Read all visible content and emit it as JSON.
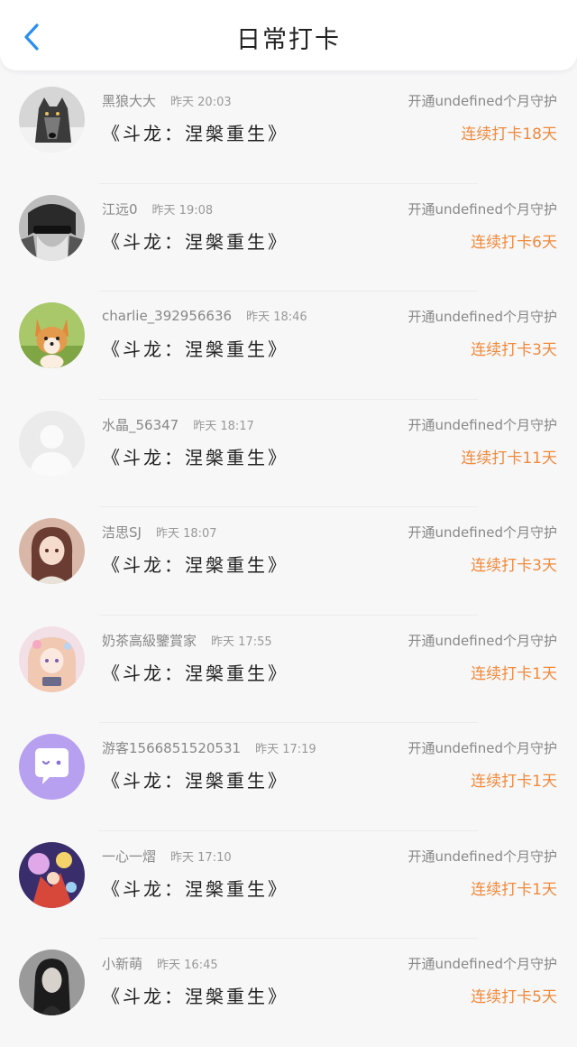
{
  "header": {
    "title": "日常打卡",
    "back_icon": "chevron-left-icon",
    "accent": "#2a8ef0"
  },
  "colors": {
    "streak": "#f08a3c",
    "secondary": "#888888",
    "background": "#f7f7f8"
  },
  "checkins": [
    {
      "name": "黑狼大大",
      "time": "昨天 20:03",
      "book": "《斗龙：涅槃重生》",
      "guard": "开通undefined个月守护",
      "streak": "连续打卡18天",
      "avatar": "wolf-avatar"
    },
    {
      "name": "江远0",
      "time": "昨天 19:08",
      "book": "《斗龙：涅槃重生》",
      "guard": "开通undefined个月守护",
      "streak": "连续打卡6天",
      "avatar": "manga-avatar"
    },
    {
      "name": "charlie_392956636",
      "time": "昨天 18:46",
      "book": "《斗龙：涅槃重生》",
      "guard": "开通undefined个月守护",
      "streak": "连续打卡3天",
      "avatar": "corgi-avatar"
    },
    {
      "name": "水晶_56347",
      "time": "昨天 18:17",
      "book": "《斗龙：涅槃重生》",
      "guard": "开通undefined个月守护",
      "streak": "连续打卡11天",
      "avatar": "default-avatar"
    },
    {
      "name": "洁思SJ",
      "time": "昨天 18:07",
      "book": "《斗龙：涅槃重生》",
      "guard": "开通undefined个月守护",
      "streak": "连续打卡3天",
      "avatar": "anime-girl-avatar"
    },
    {
      "name": "奶茶高級鑒賞家",
      "time": "昨天 17:55",
      "book": "《斗龙：涅槃重生》",
      "guard": "开通undefined个月守护",
      "streak": "连续打卡1天",
      "avatar": "pink-anime-avatar"
    },
    {
      "name": "游客1566851520531",
      "time": "昨天 17:19",
      "book": "《斗龙：涅槃重生》",
      "guard": "开通undefined个月守护",
      "streak": "连续打卡1天",
      "avatar": "chat-bubble-avatar"
    },
    {
      "name": "一心一熠",
      "time": "昨天 17:10",
      "book": "《斗龙：涅槃重生》",
      "guard": "开通undefined个月守护",
      "streak": "连续打卡1天",
      "avatar": "colorful-art-avatar"
    },
    {
      "name": "小新萌",
      "time": "昨天 16:45",
      "book": "《斗龙：涅槃重生》",
      "guard": "开通undefined个月守护",
      "streak": "连续打卡5天",
      "avatar": "dark-hair-avatar"
    }
  ]
}
